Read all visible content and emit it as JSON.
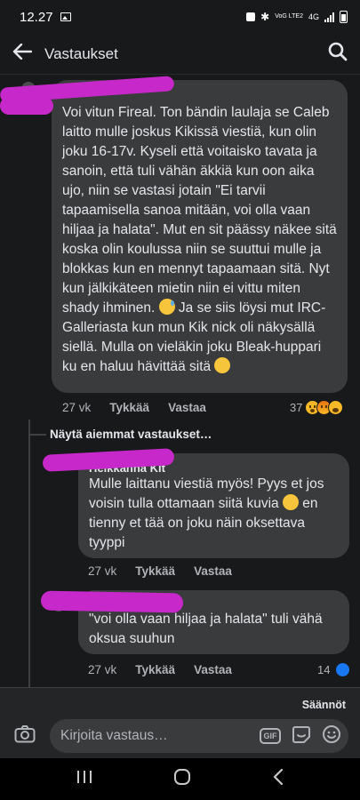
{
  "status_bar": {
    "time": "12.27",
    "network_label": "4G",
    "volte_label": "VoG LTE2"
  },
  "app_bar": {
    "title": "Vastaukset"
  },
  "comments": [
    {
      "author": "",
      "text_part1": "Voi vitun Fireal. Ton bändin laulaja se Caleb laitto mulle joskus Kikissä viestiä, kun olin joku 16-17v. Kyseli että voitaisko tavata ja sanoin, että tuli vähän äkkiä kun oon aika ujo, niin se vastasi jotain \"Ei tarvii tapaamisella sanoa mitään, voi olla vaan hiljaa ja halata\". Mut en sit päässy näkee sitä koska olin koulussa niin se suuttui mulle ja blokkas kun en mennyt tapaamaan sitä. Nyt kun jälkikäteen mietin niin ei vittu miten shady ihminen.",
      "text_part2": "Ja se siis löysi mut IRC-Galleriasta kun mun Kik nick oli näkysällä siellä. Mulla on vieläkin joku Bleak-huppari ku en haluu hävittää sitä",
      "time": "27 vk",
      "like": "Tykkää",
      "reply": "Vastaa",
      "reaction_count": "37"
    },
    {
      "author": "Heikkanna Kit",
      "text_part1": "Mulle laittanu viestiä myös! Pyys et jos voisin tulla ottamaan siitä kuvia",
      "text_part2": "en tienny et tää on joku näin oksettava tyyppi",
      "time": "27 vk",
      "like": "Tykkää",
      "reply": "Vastaa"
    },
    {
      "author": "",
      "text": "\"voi olla vaan hiljaa ja halata\" tuli vähä oksua suuhun",
      "time": "27 vk",
      "like": "Tykkää",
      "reply": "Vastaa",
      "reaction_count": "14"
    }
  ],
  "more_replies": "Näytä aiemmat vastaukset…",
  "footer": {
    "rules": "Säännöt",
    "composer_placeholder": "Kirjoita vastaus…",
    "gif": "GIF"
  },
  "icons": [
    "back-arrow-icon",
    "search-icon",
    "camera-icon",
    "gif-icon",
    "sticker-icon",
    "emoji-icon",
    "recent-apps-icon",
    "home-icon",
    "back-icon"
  ],
  "colors": {
    "background": "#18191a",
    "bubble": "#3a3b3c",
    "scribble": "#c728c9",
    "like_blue": "#1877f2"
  }
}
